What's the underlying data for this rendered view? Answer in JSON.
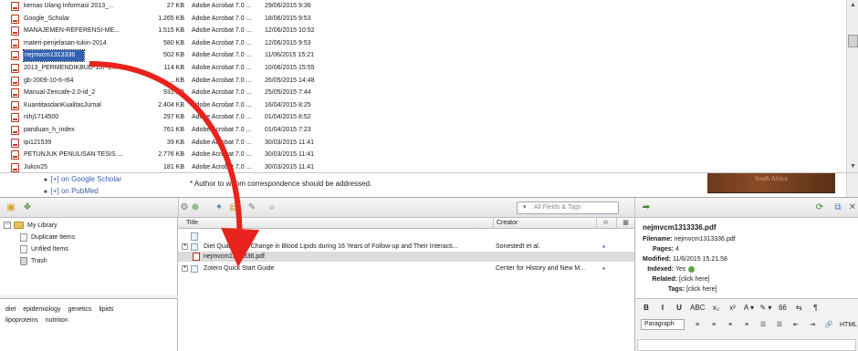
{
  "explorer": {
    "files": [
      {
        "name": "kemas Ulang Informasi 2013_...",
        "size": "27 KB",
        "type": "Adobe Acrobat 7.0 ...",
        "date": "29/06/2015 9:36"
      },
      {
        "name": "Google_Scholar",
        "size": "1.265 KB",
        "type": "Adobe Acrobat 7.0 ...",
        "date": "18/06/2015 9:53"
      },
      {
        "name": "MANAJEMEN-REFERENSI-ME...",
        "size": "1.515 KB",
        "type": "Adobe Acrobat 7.0 ...",
        "date": "12/06/2015 10:52"
      },
      {
        "name": "materi-penjelasan-tukin-2014",
        "size": "580 KB",
        "type": "Adobe Acrobat 7.0 ...",
        "date": "12/06/2015 9:53"
      },
      {
        "name": "nejmvcm1313336",
        "size": "502 KB",
        "type": "Adobe Acrobat 7.0 ...",
        "date": "11/06/2015 15:21",
        "selected": true
      },
      {
        "name": "2013_PERMENDIKBUD-107-2...",
        "size": "114 KB",
        "type": "Adobe Acrobat 7.0 ...",
        "date": "10/06/2015 15:55"
      },
      {
        "name": "gb-2009-10-6-r64",
        "size": "...KB",
        "type": "Adobe Acrobat 7.0 ...",
        "date": "26/05/2015 14:48"
      },
      {
        "name": "Manual-Zencafe-2.0-id_2",
        "size": "931 KB",
        "type": "Adobe Acrobat 7.0 ...",
        "date": "25/05/2015 7:44"
      },
      {
        "name": "KuantitasdanKualitasJurnal",
        "size": "2.404 KB",
        "type": "Adobe Acrobat 7.0 ...",
        "date": "16/04/2015 8:25"
      },
      {
        "name": "nihj1714500",
        "size": "297 KB",
        "type": "Adobe Acrobat 7.0 ...",
        "date": "01/04/2015 8:52"
      },
      {
        "name": "panduan_h_index",
        "size": "761 KB",
        "type": "Adobe Acrobat 7.0 ...",
        "date": "01/04/2015 7:23"
      },
      {
        "name": "ipi121539",
        "size": "39 KB",
        "type": "Adobe Acrobat 7.0 ...",
        "date": "30/03/2015 11:41"
      },
      {
        "name": "PETUNJUK PENULISAN TESIS ...",
        "size": "2.776 KB",
        "type": "Adobe Acrobat 7.0 ...",
        "date": "30/03/2015 11:41"
      },
      {
        "name": "Jukov25",
        "size": "181 KB",
        "type": "Adobe Acrobat 7.0 ...",
        "date": "30/03/2015 11:41"
      }
    ]
  },
  "browser": {
    "links": [
      "[+] on Google Scholar",
      "[+] on PubMed"
    ],
    "note": "* Author to whom correspondence should be addressed.",
    "image_text": "South Africa"
  },
  "zotero": {
    "search": {
      "placeholder": "All Fields & Tags"
    },
    "library": {
      "root": "My Library",
      "items": [
        "Duplicate Items",
        "Unfiled Items",
        "Trash"
      ]
    },
    "tags": [
      "diet",
      "epidemiology",
      "genetics",
      "lipids",
      "lipoproteins",
      "nutrition"
    ],
    "columns": {
      "title": "Title",
      "creator": "Creator"
    },
    "items": [
      {
        "title": "Diet Quality and Change in Blood Lipids during 16 Years of Follow-up and Their Interacti...",
        "creator": "Sonestedt et al.",
        "kind": "article",
        "expander": "+"
      },
      {
        "title": "nejmvcm1313336.pdf",
        "creator": "",
        "kind": "pdf",
        "selected": true
      },
      {
        "title": "Zotero Quick Start Guide",
        "creator": "Center for History and New M...",
        "kind": "webpage",
        "expander": "+"
      }
    ],
    "info": {
      "heading": "nejmvcm1313336.pdf",
      "filename_label": "Filename:",
      "filename": "nejmvcm1313336.pdf",
      "pages_label": "Pages:",
      "pages": "4",
      "modified_label": "Modified:",
      "modified": "11/6/2015 15.21.58",
      "indexed_label": "Indexed:",
      "indexed": "Yes",
      "related_label": "Related:",
      "related": "[click here]",
      "tags_label": "Tags:",
      "tags": "[click here]"
    },
    "editor": {
      "row1": [
        "B",
        "I",
        "U",
        "ABC",
        "x₂",
        "x²",
        "A ▾",
        "✎ ▾",
        "66",
        "⇆",
        "¶"
      ],
      "paragraph": "Paragraph",
      "row2": [
        "≡",
        "≡",
        "≡",
        "≡",
        "☰",
        "☰",
        "⇤",
        "⇥",
        "🔗",
        "HTML"
      ]
    }
  },
  "annotation": {
    "arrow_color": "#e8231d"
  }
}
